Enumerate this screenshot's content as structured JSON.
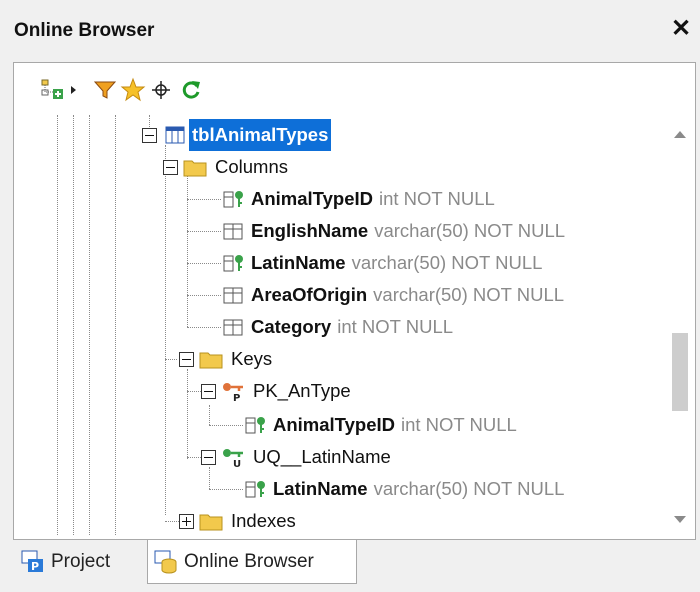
{
  "window": {
    "title": "Online Browser",
    "close_glyph": "✕"
  },
  "toolbar": {
    "icons": [
      "add-data-source-icon",
      "dropdown-arrow-icon",
      "filter-icon",
      "favorites-star-icon",
      "locate-icon",
      "refresh-icon"
    ]
  },
  "tree": {
    "table": "tblAnimalTypes",
    "columns_folder": "Columns",
    "columns": [
      {
        "name": "AnimalTypeID",
        "type": "int NOT NULL",
        "key": true
      },
      {
        "name": "EnglishName",
        "type": "varchar(50) NOT NULL",
        "key": false
      },
      {
        "name": "LatinName",
        "type": "varchar(50) NOT NULL",
        "key": true
      },
      {
        "name": "AreaOfOrigin",
        "type": "varchar(50) NOT NULL",
        "key": false
      },
      {
        "name": "Category",
        "type": "int NOT NULL",
        "key": false
      }
    ],
    "keys_folder": "Keys",
    "pk": {
      "name": "PK_AnType",
      "col": "AnimalTypeID",
      "type": "int NOT NULL"
    },
    "uq": {
      "name": "UQ__LatinName",
      "col": "LatinName",
      "type": "varchar(50) NOT NULL"
    },
    "indexes_folder": "Indexes"
  },
  "tabs": [
    {
      "label": "Project",
      "active": false
    },
    {
      "label": "Online Browser",
      "active": true
    }
  ],
  "colors": {
    "selection": "#0e6fd8",
    "folder": "#f2c94c",
    "key": "#3aa24a",
    "pk_key": "#e0723a"
  }
}
